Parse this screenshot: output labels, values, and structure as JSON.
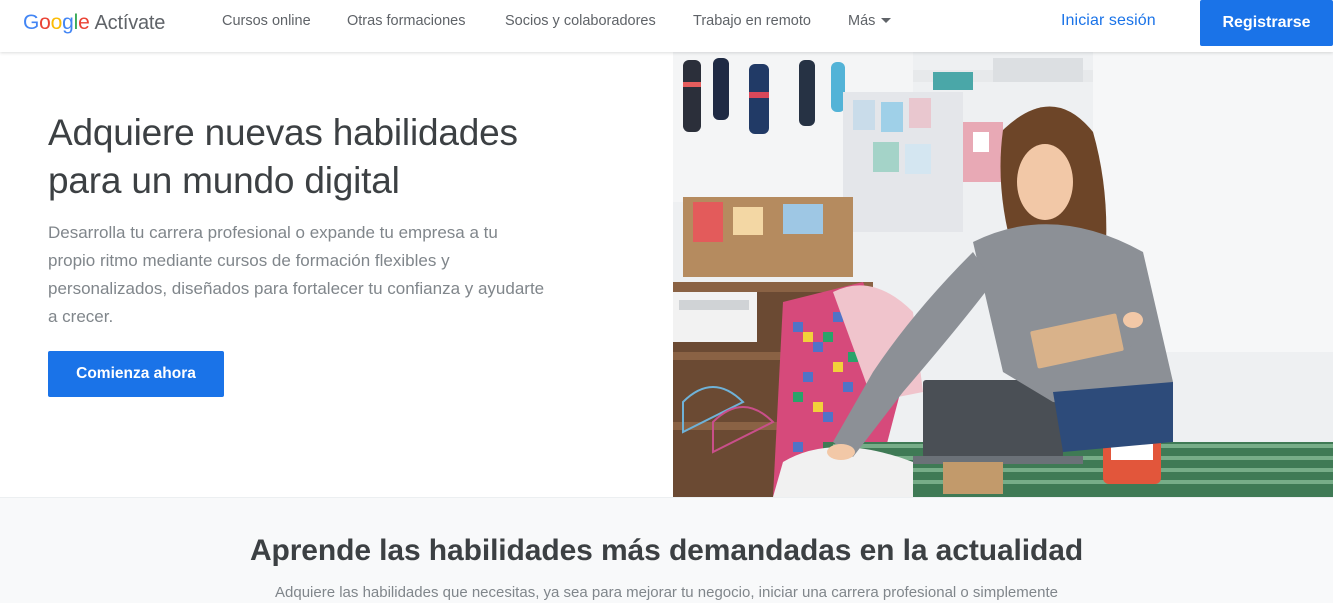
{
  "header": {
    "logo": {
      "letters": [
        "G",
        "o",
        "o",
        "g",
        "l",
        "e"
      ],
      "product": "Actívate"
    },
    "nav": [
      "Cursos online",
      "Otras formaciones",
      "Socios y colaboradores",
      "Trabajo en remoto"
    ],
    "more_label": "Más",
    "signin_label": "Iniciar sesión",
    "register_label": "Registrarse"
  },
  "hero": {
    "title_line1": "Adquiere nuevas habilidades",
    "title_line2": "para un mundo digital",
    "description": "Desarrolla tu carrera profesional o expande tu empresa a tu propio ritmo mediante cursos de formación flexibles y personalizados, diseñados para fortalecer tu confianza y ayudarte a crecer.",
    "cta_label": "Comienza ahora"
  },
  "section2": {
    "title": "Aprende las habilidades más demandadas en la actualidad",
    "description": "Adquiere las habilidades que necesitas, ya sea para mejorar tu negocio, iniciar una carrera profesional o simplemente"
  },
  "colors": {
    "accent": "#1a73e8",
    "text_primary": "#3c4043",
    "text_secondary": "#80868b",
    "section_bg": "#f8f9fa"
  },
  "icons": {
    "more": "chevron-down-icon",
    "photo": "woman-packing-order-photo"
  }
}
